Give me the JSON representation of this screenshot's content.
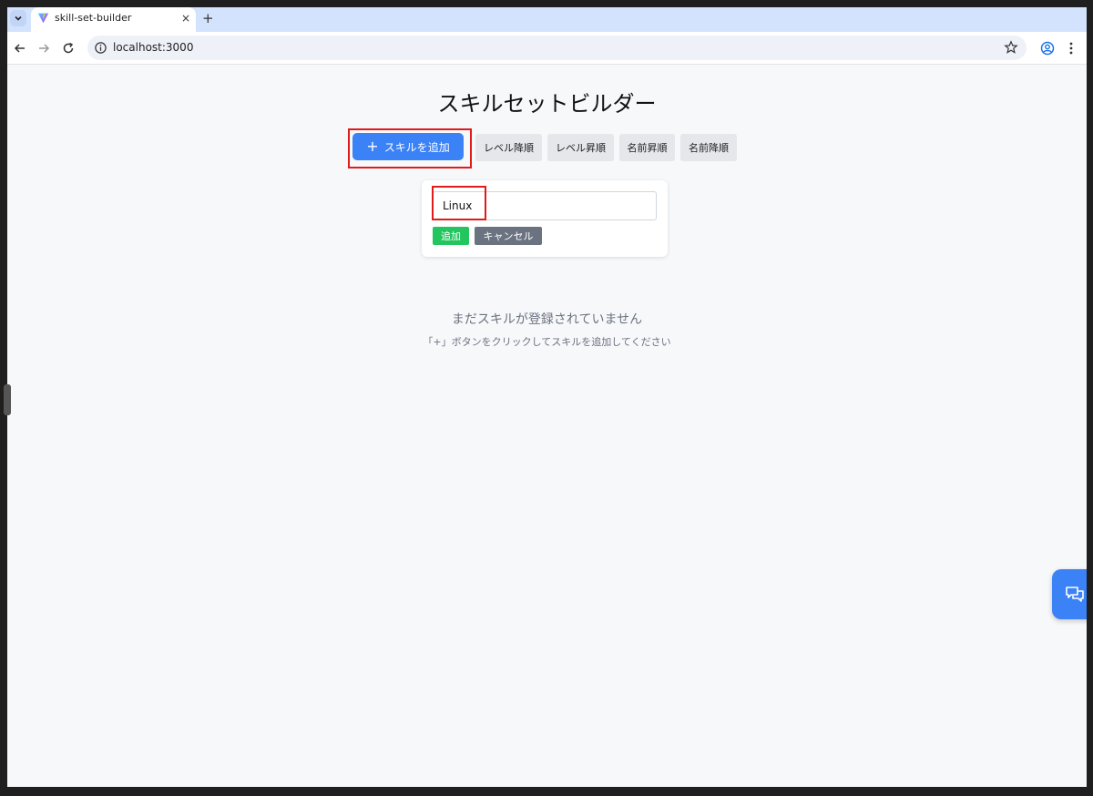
{
  "browser": {
    "tab_title": "skill-set-builder",
    "tab_close": "×",
    "new_tab": "+",
    "url": "localhost:3000"
  },
  "app": {
    "title": "スキルセットビルダー",
    "add_button": {
      "icon": "+",
      "label": "スキルを追加"
    },
    "sort_buttons": [
      {
        "label": "レベル降順"
      },
      {
        "label": "レベル昇順"
      },
      {
        "label": "名前昇順"
      },
      {
        "label": "名前降順"
      }
    ],
    "form": {
      "input_value": "Linux",
      "confirm_label": "追加",
      "cancel_label": "キャンセル"
    },
    "empty_state": {
      "title": "まだスキルが登録されていません",
      "hint": "「+」ボタンをクリックしてスキルを追加してください"
    }
  },
  "colors": {
    "primary": "#3b82f6",
    "success": "#22c55e",
    "muted": "#6b7280",
    "highlight": "#e01b1b"
  }
}
